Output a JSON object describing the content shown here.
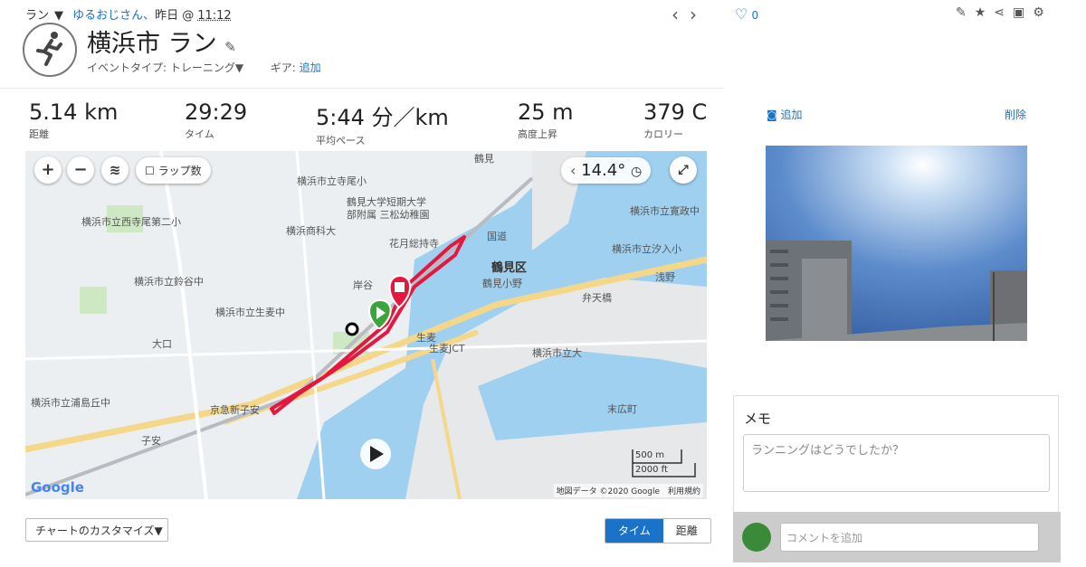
{
  "header": {
    "activity_type": "ラン",
    "dropdown_glyph": "▼",
    "owner": "ゆるおじさん、",
    "date": "昨日",
    "at": "@",
    "time": "11:12",
    "title": "横浜市 ラン",
    "event_type_label": "イベントタイプ: トレーニング▼",
    "gear_label": "ギア:",
    "gear_add": "追加"
  },
  "stats": [
    {
      "value": "5.14 km",
      "label": "距離"
    },
    {
      "value": "29:29",
      "label": "タイム"
    },
    {
      "value": "5:44 分／km",
      "label": "平均ペース"
    },
    {
      "value": "25 m",
      "label": "高度上昇"
    },
    {
      "value": "379 C",
      "label": "カロリー"
    }
  ],
  "map": {
    "lap_label": "ラップ数",
    "temperature": "14.4°",
    "zoom_in": "+",
    "zoom_out": "−",
    "district": "鶴見区",
    "labels": [
      "横浜市立寺尾小",
      "鶴見大学短期大学",
      "部附属 三松幼稚園",
      "横浜市立西寺尾第二小",
      "横浜商科大",
      "花月総持寺",
      "国道",
      "横浜市立鈴谷中",
      "横浜市立生麦中",
      "鶴見小野",
      "弁天橋",
      "浅野",
      "横浜市立汐入小",
      "大口",
      "生麦",
      "生麦JCT",
      "京急新子安",
      "子安",
      "横浜市立浦島丘中",
      "末広町",
      "岸谷",
      "鶴見",
      "横浜市立寛政中",
      "横浜市立大"
    ],
    "scale_m": "500 m",
    "scale_ft": "2000 ft",
    "attribution": "地図データ ©2020 Google　利用規約",
    "google": "Google"
  },
  "bottom": {
    "chart_customize": "チャートのカスタマイズ▼",
    "toggle_time": "タイム",
    "toggle_distance": "距離"
  },
  "side": {
    "likes": "0",
    "photo_add": "追加",
    "photo_delete": "削除",
    "memo_title": "メモ",
    "memo_placeholder": "ランニングはどうでしたか？",
    "comment_placeholder": "コメントを追加"
  },
  "colors": {
    "accent": "#1a73c8",
    "route": "#e5173f",
    "start": "#3aa53a"
  }
}
